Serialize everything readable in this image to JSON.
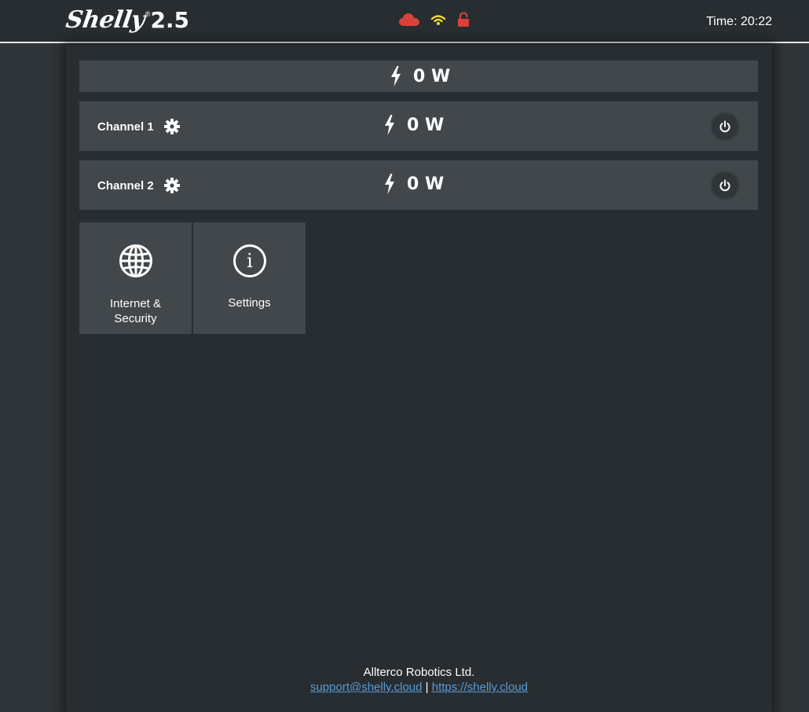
{
  "header": {
    "brand": "Shelly",
    "registered": "®",
    "model": "2.5",
    "time_label": "Time: 20:22",
    "icons": {
      "cloud": {
        "name": "cloud-icon",
        "color": "#d9413a"
      },
      "wifi": {
        "name": "wifi-icon",
        "color": "#f2d92e"
      },
      "lock": {
        "name": "unlocked-icon",
        "color": "#d9413a"
      }
    }
  },
  "total": {
    "power": "0 W"
  },
  "channels": [
    {
      "label": "Channel 1",
      "power": "0 W"
    },
    {
      "label": "Channel 2",
      "power": "0 W"
    }
  ],
  "tiles": {
    "internet": {
      "line1": "Internet &",
      "line2": "Security",
      "icon": "globe-icon"
    },
    "settings": {
      "label": "Settings",
      "icon": "info-icon"
    }
  },
  "footer": {
    "company": "Allterco Robotics Ltd.",
    "email": "support@shelly.cloud",
    "separator": "|",
    "website": "https://shelly.cloud"
  },
  "colors": {
    "background": "#2e3437",
    "panel": "#272d30",
    "row": "#41474a",
    "link": "#5a9ad6"
  }
}
